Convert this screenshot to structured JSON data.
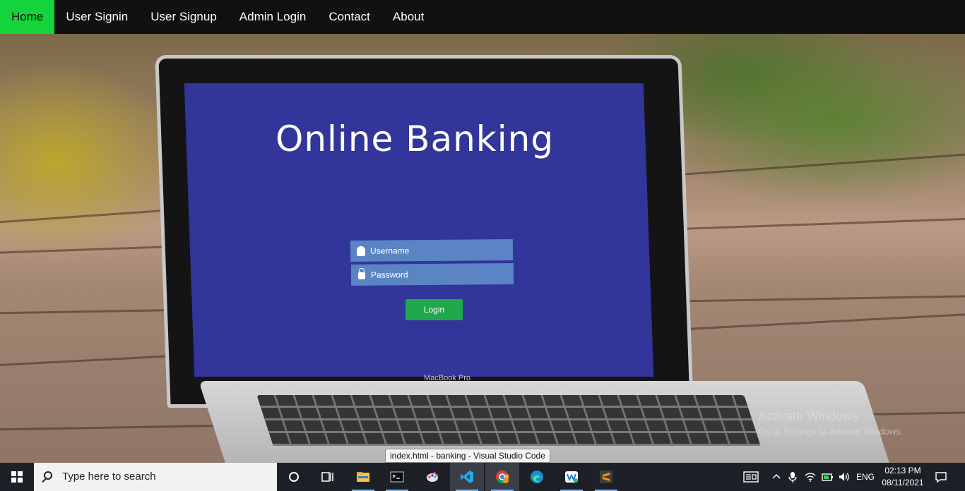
{
  "nav": {
    "items": [
      {
        "label": "Home",
        "active": true
      },
      {
        "label": "User Signin"
      },
      {
        "label": "User Signup"
      },
      {
        "label": "Admin Login"
      },
      {
        "label": "Contact"
      },
      {
        "label": "About"
      }
    ],
    "active_color": "#14d33b"
  },
  "hero": {
    "screen_title": "Online Banking",
    "username_placeholder": "Username",
    "password_placeholder": "Password",
    "login_label": "Login",
    "laptop_label": "MacBook Pro"
  },
  "watermark": {
    "line1": "Activate Windows",
    "line2": "Go to Settings to activate Windows."
  },
  "tooltip": "index.html - banking - Visual Studio Code",
  "taskbar": {
    "search_placeholder": "Type here to search",
    "apps": [
      "cortana-icon",
      "task-view-icon",
      "file-explorer-icon",
      "terminal-icon",
      "paint-icon",
      "vscode-icon",
      "chrome-icon",
      "edge-icon",
      "messaging-icon",
      "sublime-text-icon"
    ],
    "language": "ENG",
    "time": "02:13 PM",
    "date": "08/11/2021"
  }
}
